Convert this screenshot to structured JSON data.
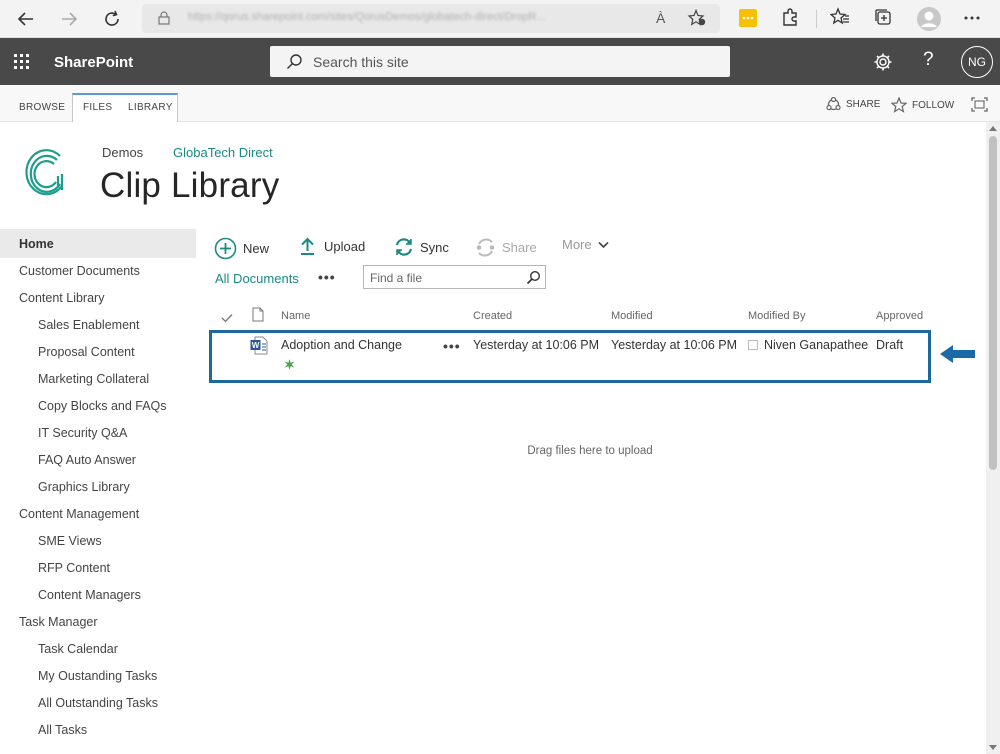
{
  "browser": {
    "url": "https://qorus.sharepoint.com/sites/QorusDemos/globatech-direct/DropR...",
    "read_aloud_label": "À"
  },
  "suite": {
    "brand": "SharePoint",
    "search_placeholder": "Search this site",
    "help_label": "?",
    "user_initials": "NG"
  },
  "ribbon": {
    "tabs": [
      "BROWSE",
      "FILES",
      "LIBRARY"
    ],
    "share_label": "SHARE",
    "follow_label": "FOLLOW"
  },
  "header": {
    "breadcrumb_parent": "Demos",
    "breadcrumb_site": "GlobaTech Direct",
    "title": "Clip Library"
  },
  "left_nav": [
    {
      "label": "Home",
      "level": 0
    },
    {
      "label": "Customer Documents",
      "level": 0
    },
    {
      "label": "Content Library",
      "level": 0
    },
    {
      "label": "Sales Enablement",
      "level": 1
    },
    {
      "label": "Proposal Content",
      "level": 1
    },
    {
      "label": "Marketing Collateral",
      "level": 1
    },
    {
      "label": "Copy Blocks and FAQs",
      "level": 1
    },
    {
      "label": "IT Security Q&A",
      "level": 1
    },
    {
      "label": "FAQ Auto Answer",
      "level": 1
    },
    {
      "label": "Graphics Library",
      "level": 1
    },
    {
      "label": "Content Management",
      "level": 0
    },
    {
      "label": "SME Views",
      "level": 1
    },
    {
      "label": "RFP Content",
      "level": 1
    },
    {
      "label": "Content Managers",
      "level": 1
    },
    {
      "label": "Task Manager",
      "level": 0
    },
    {
      "label": "Task Calendar",
      "level": 1
    },
    {
      "label": "My Oustanding Tasks",
      "level": 1
    },
    {
      "label": "All Outstanding Tasks",
      "level": 1
    },
    {
      "label": "All Tasks",
      "level": 1
    }
  ],
  "commands": {
    "new": "New",
    "upload": "Upload",
    "sync": "Sync",
    "share": "Share",
    "more": "More"
  },
  "view": {
    "name": "All Documents",
    "find_placeholder": "Find a file"
  },
  "columns": {
    "name": "Name",
    "created": "Created",
    "modified": "Modified",
    "modified_by": "Modified By",
    "approved": "Approved"
  },
  "rows": [
    {
      "name": "Adoption and Change",
      "created": "Yesterday at 10:06 PM",
      "modified": "Yesterday at 10:06 PM",
      "modified_by": "Niven Ganapathee",
      "approved": "Draft"
    }
  ],
  "drag_hint": "Drag files here to upload",
  "colors": {
    "suite_bar": "#494949",
    "accent": "#1a8a83",
    "highlight_box": "#1b6a9a",
    "arrow": "#1b6aa8"
  },
  "icons": [
    "back-icon",
    "forward-icon",
    "refresh-icon",
    "lock-icon",
    "favorite-add-icon",
    "extension-icon",
    "puzzle-icon",
    "favorites-icon",
    "collections-icon",
    "profile-icon",
    "more-icon",
    "waffle-icon",
    "search-icon",
    "gear-icon",
    "share-icon",
    "star-icon",
    "focus-icon",
    "new-icon",
    "upload-icon",
    "sync-icon",
    "word-doc-icon",
    "new-item-icon",
    "arrow-left-icon"
  ]
}
